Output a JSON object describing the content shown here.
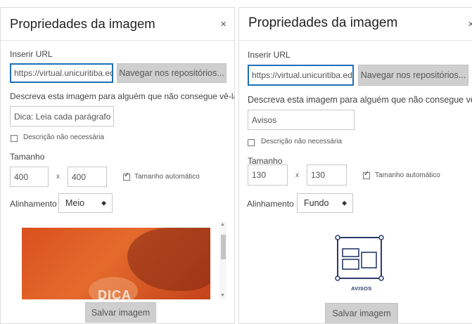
{
  "left_dialog": {
    "title": "Propriedades da imagem",
    "close_label": "×",
    "url_label": "Inserir URL",
    "url_value": "https://virtual.unicuritiba.edu",
    "browse_button": "Navegar nos repositórios...",
    "describe_label": "Descreva esta imagem para alguém que não consegue vê-la",
    "description_value": "Dica: Leia cada parágrafo se",
    "not_needed_label": "Descrição não necessária",
    "size_label": "Tamanho",
    "width": "400",
    "height": "400",
    "times": "x",
    "auto_size_label": "Tamanho automático",
    "align_label": "Alinhamento",
    "align_value": "Meio",
    "preview_text": "DICA",
    "save_button": "Salvar imagem"
  },
  "right_dialog": {
    "title": "Propriedades da imagem",
    "close_label": "×",
    "url_label": "Inserir URL",
    "url_value": "https://virtual.unicuritiba.edu",
    "browse_button": "Navegar nos repositórios...",
    "describe_label": "Descreva esta imagem para alguém que não consegue vê-la",
    "description_value": "Avisos",
    "not_needed_label": "Descrição não necessária",
    "size_label": "Tamanho",
    "width": "130",
    "height": "130",
    "times": "x",
    "auto_size_label": "Tamanho automático",
    "align_label": "Alinhamento",
    "align_value": "Fundo",
    "preview_caption": "AVISOS",
    "save_button": "Salvar imagem"
  },
  "colors": {
    "focus_border": "#1f6fb8",
    "button_gray": "#cfcfcf",
    "preview_orange": "#e0612a",
    "icon_navy": "#2a3a6a"
  }
}
